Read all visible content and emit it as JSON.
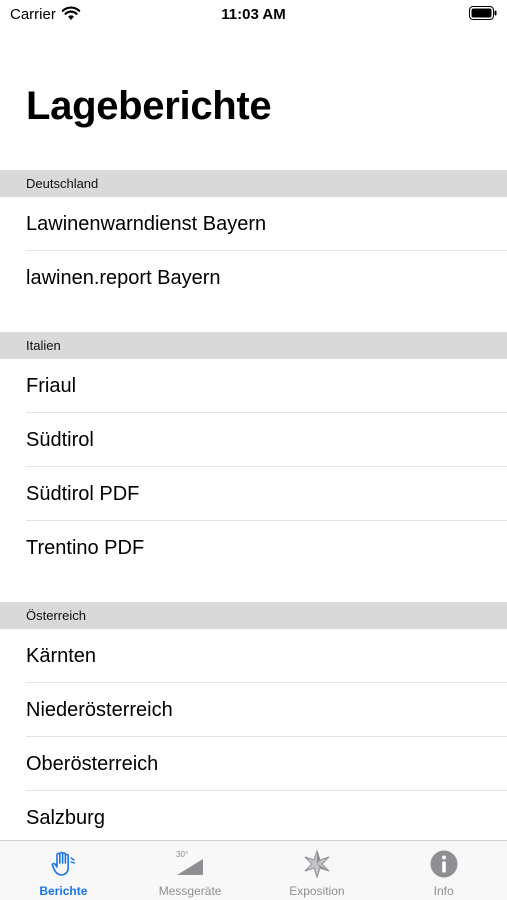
{
  "status_bar": {
    "carrier": "Carrier",
    "time": "11:03 AM"
  },
  "page": {
    "title": "Lageberichte"
  },
  "sections": [
    {
      "header": "Deutschland",
      "items": [
        "Lawinenwarndienst Bayern",
        "lawinen.report Bayern"
      ]
    },
    {
      "header": "Italien",
      "items": [
        "Friaul",
        "Südtirol",
        "Südtirol PDF",
        "Trentino PDF"
      ]
    },
    {
      "header": "Österreich",
      "items": [
        "Kärnten",
        "Niederösterreich",
        "Oberösterreich",
        "Salzburg"
      ]
    }
  ],
  "tab_bar": {
    "tabs": [
      {
        "label": "Berichte",
        "icon": "hand-icon",
        "active": true
      },
      {
        "label": "Messgeräte",
        "icon": "slope-icon",
        "active": false,
        "icon_text": "30°"
      },
      {
        "label": "Exposition",
        "icon": "compass-rose-icon",
        "active": false
      },
      {
        "label": "Info",
        "icon": "info-icon",
        "active": false
      }
    ]
  },
  "colors": {
    "accent": "#1a73e8",
    "section_bg": "#d9d9d9",
    "inactive": "#8e8e93"
  }
}
